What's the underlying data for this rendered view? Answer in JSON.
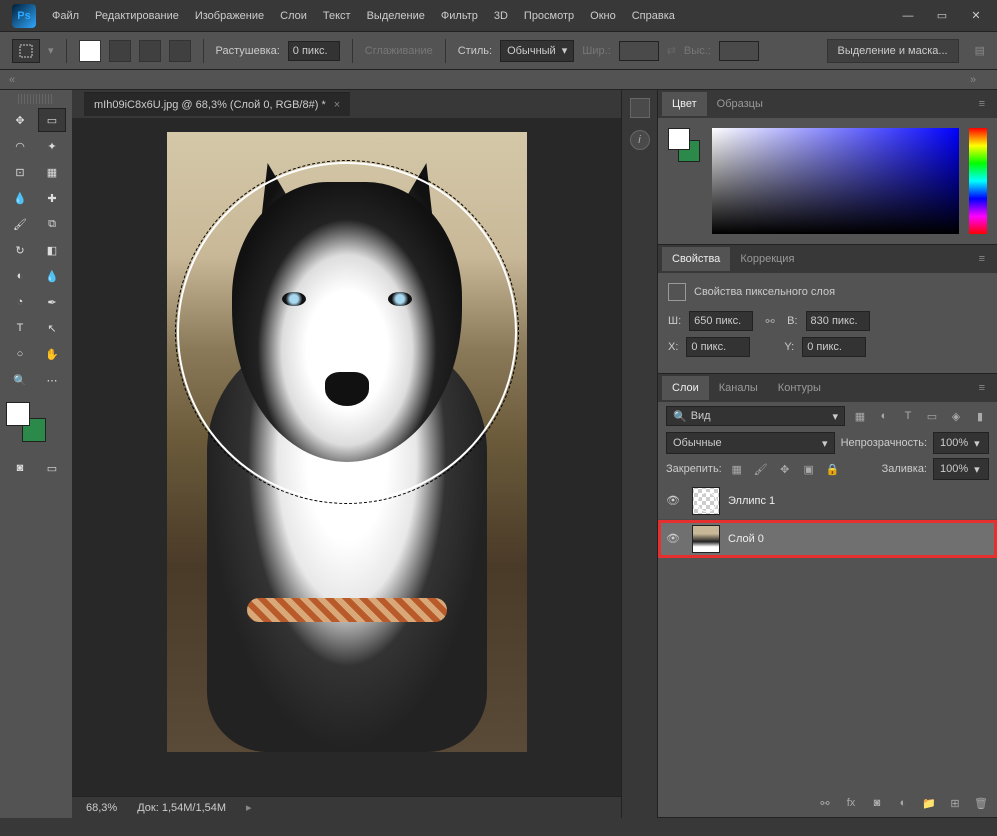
{
  "menu": [
    "Файл",
    "Редактирование",
    "Изображение",
    "Слои",
    "Текст",
    "Выделение",
    "Фильтр",
    "3D",
    "Просмотр",
    "Окно",
    "Справка"
  ],
  "options": {
    "feather_label": "Растушевка:",
    "feather_value": "0 пикс.",
    "antialias": "Сглаживание",
    "style_label": "Стиль:",
    "style_value": "Обычный",
    "width_label": "Шир.:",
    "height_label": "Выс.:",
    "select_mask": "Выделение и маска..."
  },
  "document": {
    "tab_title": "mIh09iC8x6U.jpg @ 68,3% (Слой 0, RGB/8#) *",
    "zoom": "68,3%",
    "doc_size_label": "Док:",
    "doc_size": "1,54M/1,54M"
  },
  "panels": {
    "color": {
      "tab1": "Цвет",
      "tab2": "Образцы"
    },
    "properties": {
      "tab1": "Свойства",
      "tab2": "Коррекция",
      "title": "Свойства пиксельного слоя",
      "w_label": "Ш:",
      "w_value": "650 пикс.",
      "h_label": "В:",
      "h_value": "830 пикс.",
      "x_label": "X:",
      "x_value": "0 пикс.",
      "y_label": "Y:",
      "y_value": "0 пикс."
    },
    "layers": {
      "tab1": "Слои",
      "tab2": "Каналы",
      "tab3": "Контуры",
      "search_label": "Вид",
      "blend_mode": "Обычные",
      "opacity_label": "Непрозрачность:",
      "opacity_value": "100%",
      "lock_label": "Закрепить:",
      "fill_label": "Заливка:",
      "fill_value": "100%",
      "items": [
        {
          "name": "Эллипс 1",
          "selected": false,
          "highlighted": false,
          "type": "shape"
        },
        {
          "name": "Слой 0",
          "selected": true,
          "highlighted": true,
          "type": "image"
        }
      ]
    }
  },
  "colors": {
    "fg": "#ffffff",
    "bg": "#2b8a4a"
  }
}
